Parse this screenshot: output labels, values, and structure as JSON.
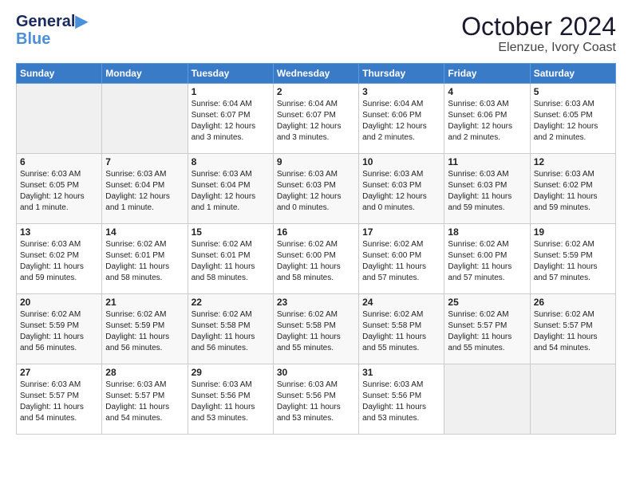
{
  "header": {
    "logo_line1": "General",
    "logo_line2": "Blue",
    "month": "October 2024",
    "location": "Elenzue, Ivory Coast"
  },
  "weekdays": [
    "Sunday",
    "Monday",
    "Tuesday",
    "Wednesday",
    "Thursday",
    "Friday",
    "Saturday"
  ],
  "weeks": [
    [
      {
        "day": "",
        "info": ""
      },
      {
        "day": "",
        "info": ""
      },
      {
        "day": "1",
        "info": "Sunrise: 6:04 AM\nSunset: 6:07 PM\nDaylight: 12 hours\nand 3 minutes."
      },
      {
        "day": "2",
        "info": "Sunrise: 6:04 AM\nSunset: 6:07 PM\nDaylight: 12 hours\nand 3 minutes."
      },
      {
        "day": "3",
        "info": "Sunrise: 6:04 AM\nSunset: 6:06 PM\nDaylight: 12 hours\nand 2 minutes."
      },
      {
        "day": "4",
        "info": "Sunrise: 6:03 AM\nSunset: 6:06 PM\nDaylight: 12 hours\nand 2 minutes."
      },
      {
        "day": "5",
        "info": "Sunrise: 6:03 AM\nSunset: 6:05 PM\nDaylight: 12 hours\nand 2 minutes."
      }
    ],
    [
      {
        "day": "6",
        "info": "Sunrise: 6:03 AM\nSunset: 6:05 PM\nDaylight: 12 hours\nand 1 minute."
      },
      {
        "day": "7",
        "info": "Sunrise: 6:03 AM\nSunset: 6:04 PM\nDaylight: 12 hours\nand 1 minute."
      },
      {
        "day": "8",
        "info": "Sunrise: 6:03 AM\nSunset: 6:04 PM\nDaylight: 12 hours\nand 1 minute."
      },
      {
        "day": "9",
        "info": "Sunrise: 6:03 AM\nSunset: 6:03 PM\nDaylight: 12 hours\nand 0 minutes."
      },
      {
        "day": "10",
        "info": "Sunrise: 6:03 AM\nSunset: 6:03 PM\nDaylight: 12 hours\nand 0 minutes."
      },
      {
        "day": "11",
        "info": "Sunrise: 6:03 AM\nSunset: 6:03 PM\nDaylight: 11 hours\nand 59 minutes."
      },
      {
        "day": "12",
        "info": "Sunrise: 6:03 AM\nSunset: 6:02 PM\nDaylight: 11 hours\nand 59 minutes."
      }
    ],
    [
      {
        "day": "13",
        "info": "Sunrise: 6:03 AM\nSunset: 6:02 PM\nDaylight: 11 hours\nand 59 minutes."
      },
      {
        "day": "14",
        "info": "Sunrise: 6:02 AM\nSunset: 6:01 PM\nDaylight: 11 hours\nand 58 minutes."
      },
      {
        "day": "15",
        "info": "Sunrise: 6:02 AM\nSunset: 6:01 PM\nDaylight: 11 hours\nand 58 minutes."
      },
      {
        "day": "16",
        "info": "Sunrise: 6:02 AM\nSunset: 6:00 PM\nDaylight: 11 hours\nand 58 minutes."
      },
      {
        "day": "17",
        "info": "Sunrise: 6:02 AM\nSunset: 6:00 PM\nDaylight: 11 hours\nand 57 minutes."
      },
      {
        "day": "18",
        "info": "Sunrise: 6:02 AM\nSunset: 6:00 PM\nDaylight: 11 hours\nand 57 minutes."
      },
      {
        "day": "19",
        "info": "Sunrise: 6:02 AM\nSunset: 5:59 PM\nDaylight: 11 hours\nand 57 minutes."
      }
    ],
    [
      {
        "day": "20",
        "info": "Sunrise: 6:02 AM\nSunset: 5:59 PM\nDaylight: 11 hours\nand 56 minutes."
      },
      {
        "day": "21",
        "info": "Sunrise: 6:02 AM\nSunset: 5:59 PM\nDaylight: 11 hours\nand 56 minutes."
      },
      {
        "day": "22",
        "info": "Sunrise: 6:02 AM\nSunset: 5:58 PM\nDaylight: 11 hours\nand 56 minutes."
      },
      {
        "day": "23",
        "info": "Sunrise: 6:02 AM\nSunset: 5:58 PM\nDaylight: 11 hours\nand 55 minutes."
      },
      {
        "day": "24",
        "info": "Sunrise: 6:02 AM\nSunset: 5:58 PM\nDaylight: 11 hours\nand 55 minutes."
      },
      {
        "day": "25",
        "info": "Sunrise: 6:02 AM\nSunset: 5:57 PM\nDaylight: 11 hours\nand 55 minutes."
      },
      {
        "day": "26",
        "info": "Sunrise: 6:02 AM\nSunset: 5:57 PM\nDaylight: 11 hours\nand 54 minutes."
      }
    ],
    [
      {
        "day": "27",
        "info": "Sunrise: 6:03 AM\nSunset: 5:57 PM\nDaylight: 11 hours\nand 54 minutes."
      },
      {
        "day": "28",
        "info": "Sunrise: 6:03 AM\nSunset: 5:57 PM\nDaylight: 11 hours\nand 54 minutes."
      },
      {
        "day": "29",
        "info": "Sunrise: 6:03 AM\nSunset: 5:56 PM\nDaylight: 11 hours\nand 53 minutes."
      },
      {
        "day": "30",
        "info": "Sunrise: 6:03 AM\nSunset: 5:56 PM\nDaylight: 11 hours\nand 53 minutes."
      },
      {
        "day": "31",
        "info": "Sunrise: 6:03 AM\nSunset: 5:56 PM\nDaylight: 11 hours\nand 53 minutes."
      },
      {
        "day": "",
        "info": ""
      },
      {
        "day": "",
        "info": ""
      }
    ]
  ]
}
